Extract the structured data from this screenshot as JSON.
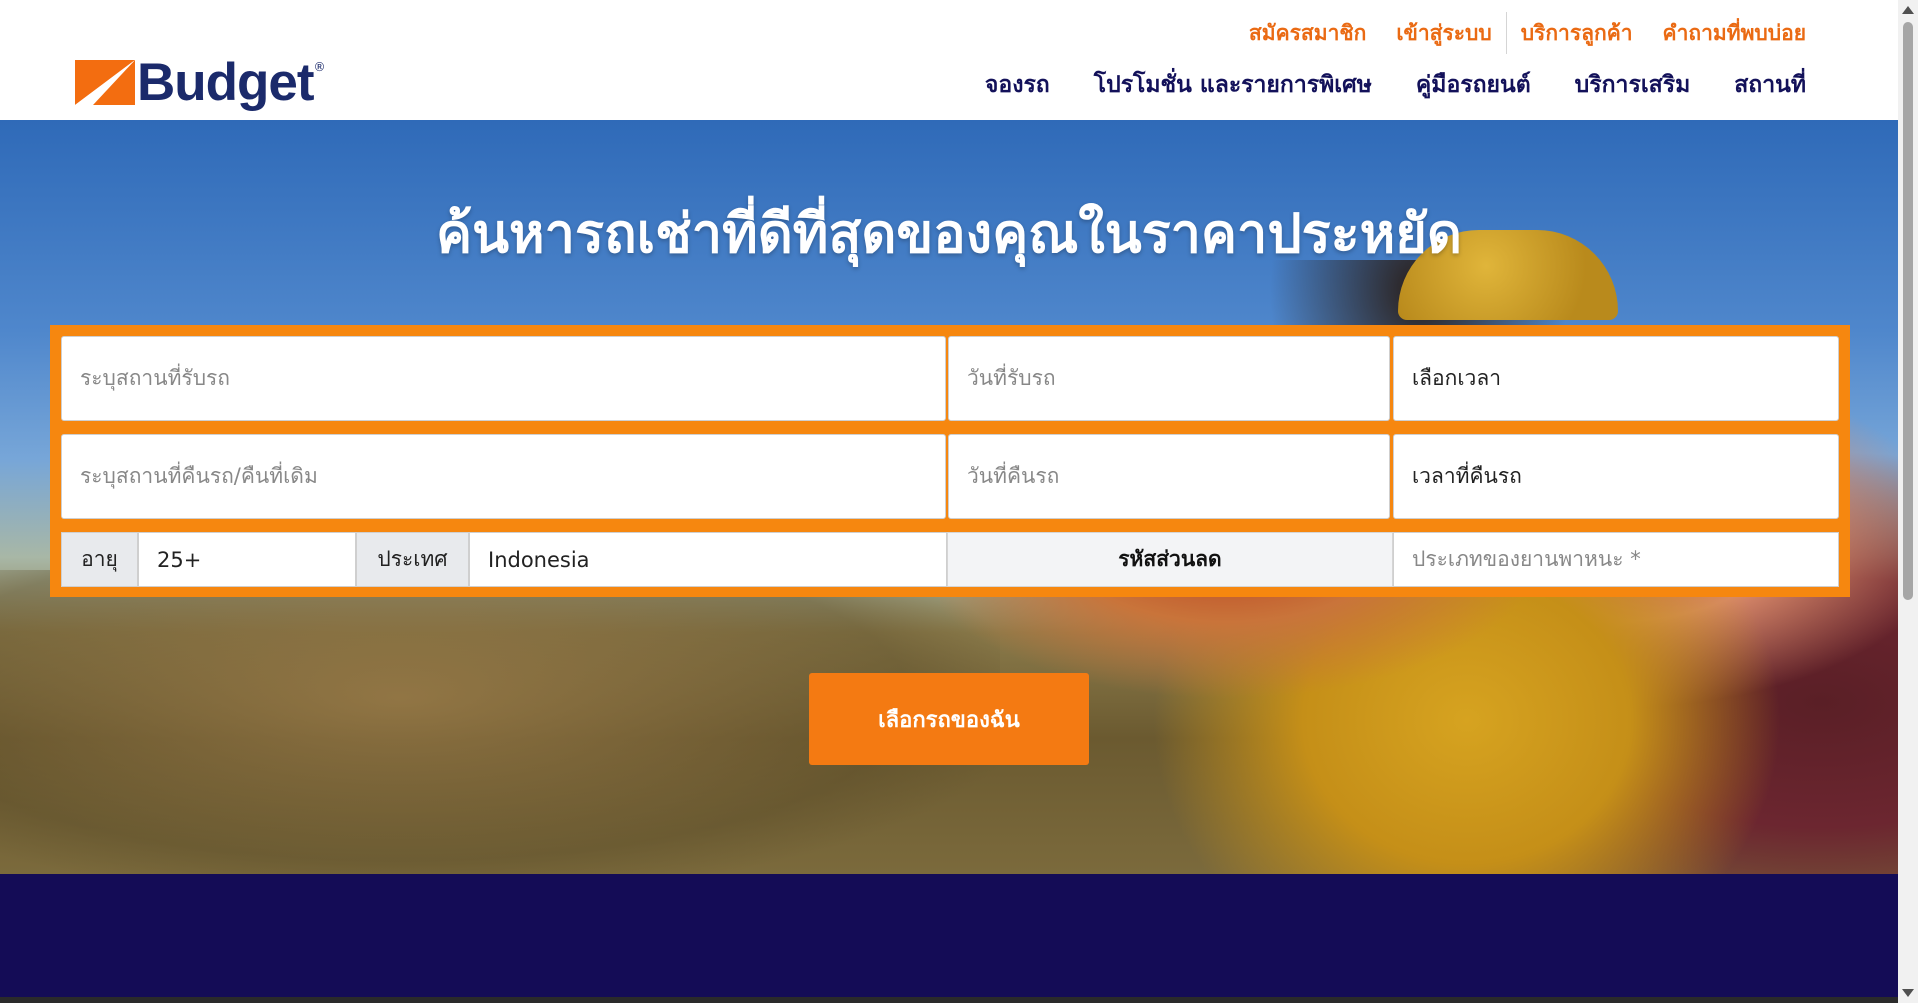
{
  "brand": {
    "name": "Budget",
    "registered": "®",
    "colors": {
      "orange": "#f6870f",
      "navy": "#13115a",
      "accent": "#ea6a13"
    }
  },
  "top_links": [
    {
      "label": "สมัครสมาชิก"
    },
    {
      "label": "เข้าสู่ระบบ"
    },
    {
      "label": "บริการลูกค้า"
    },
    {
      "label": "คำถามที่พบบ่อย"
    }
  ],
  "nav": [
    {
      "label": "จองรถ"
    },
    {
      "label": "โปรโมชั่น และรายการพิเศษ"
    },
    {
      "label": "คู่มือรถยนต์"
    },
    {
      "label": "บริการเสริม"
    },
    {
      "label": "สถานที่"
    }
  ],
  "hero": {
    "title": "ค้นหารถเช่าที่ดีที่สุดของคุณในราคาประหยัด"
  },
  "search": {
    "pickup_location_placeholder": "ระบุสถานที่รับรถ",
    "pickup_date_placeholder": "วันที่รับรถ",
    "pickup_time": "เลือกเวลา",
    "return_location_placeholder": "ระบุสถานที่คืนรถ/คืนที่เดิม",
    "return_date_placeholder": "วันที่คืนรถ",
    "return_time": "เวลาที่คืนรถ",
    "age_label": "อายุ",
    "age_value": "25+",
    "country_label": "ประเทศ",
    "country_value": "Indonesia",
    "promo_code_label": "รหัสส่วนลด",
    "vehicle_type_placeholder": "ประเภทของยานพาหนะ *",
    "submit_label": "เลือกรถของฉัน"
  }
}
